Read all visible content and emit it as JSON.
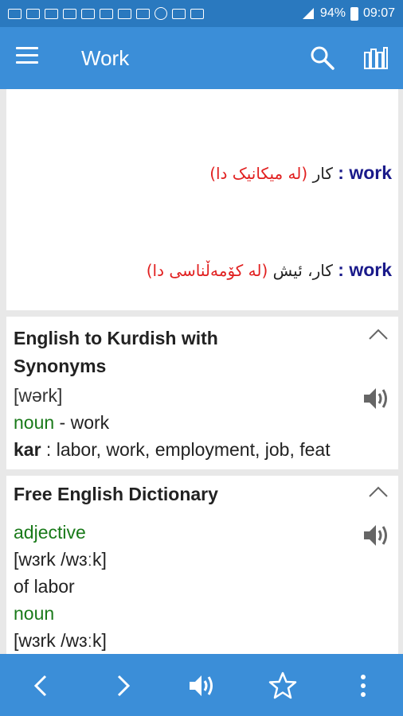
{
  "status": {
    "battery": "94%",
    "time": "09:07"
  },
  "app_bar": {
    "title": "Work"
  },
  "card1": {
    "entries": [
      {
        "word": "work",
        "colon": ":",
        "context": "(له میکانیک دا)",
        "meaning": "کار"
      },
      {
        "word": "work",
        "colon": ":",
        "context": "(له کۆمەڵناسی دا)",
        "meaning": "کار، ئیش"
      }
    ]
  },
  "card2": {
    "title_line1": "English to Kurdish with",
    "title_line2": "Synonyms",
    "pronunciation": "[wərk]",
    "pos": "noun",
    "pos_sep": " - ",
    "pos_word": "work",
    "head": "kar",
    "synonyms": " : labor, work, employment, job, feat"
  },
  "card3": {
    "title": "Free English Dictionary",
    "lines": [
      "adjective",
      "[wɜrk /wɜːk]",
      "of labor",
      "noun",
      "[wɜrk /wɜːk]"
    ]
  },
  "icons": {
    "menu": "hamburger-icon",
    "search": "search-icon",
    "books": "books-icon",
    "speaker": "speaker-icon",
    "collapse": "chevron-up-icon",
    "back": "chevron-left-icon",
    "forward": "chevron-right-icon",
    "star": "star-icon",
    "more": "more-vertical-icon"
  },
  "colors": {
    "app_bar": "#3b8ed8",
    "status_bar": "#2a79bf",
    "headword": "#1a1a8a",
    "context": "#e12020",
    "pos": "#1a7a1a"
  }
}
